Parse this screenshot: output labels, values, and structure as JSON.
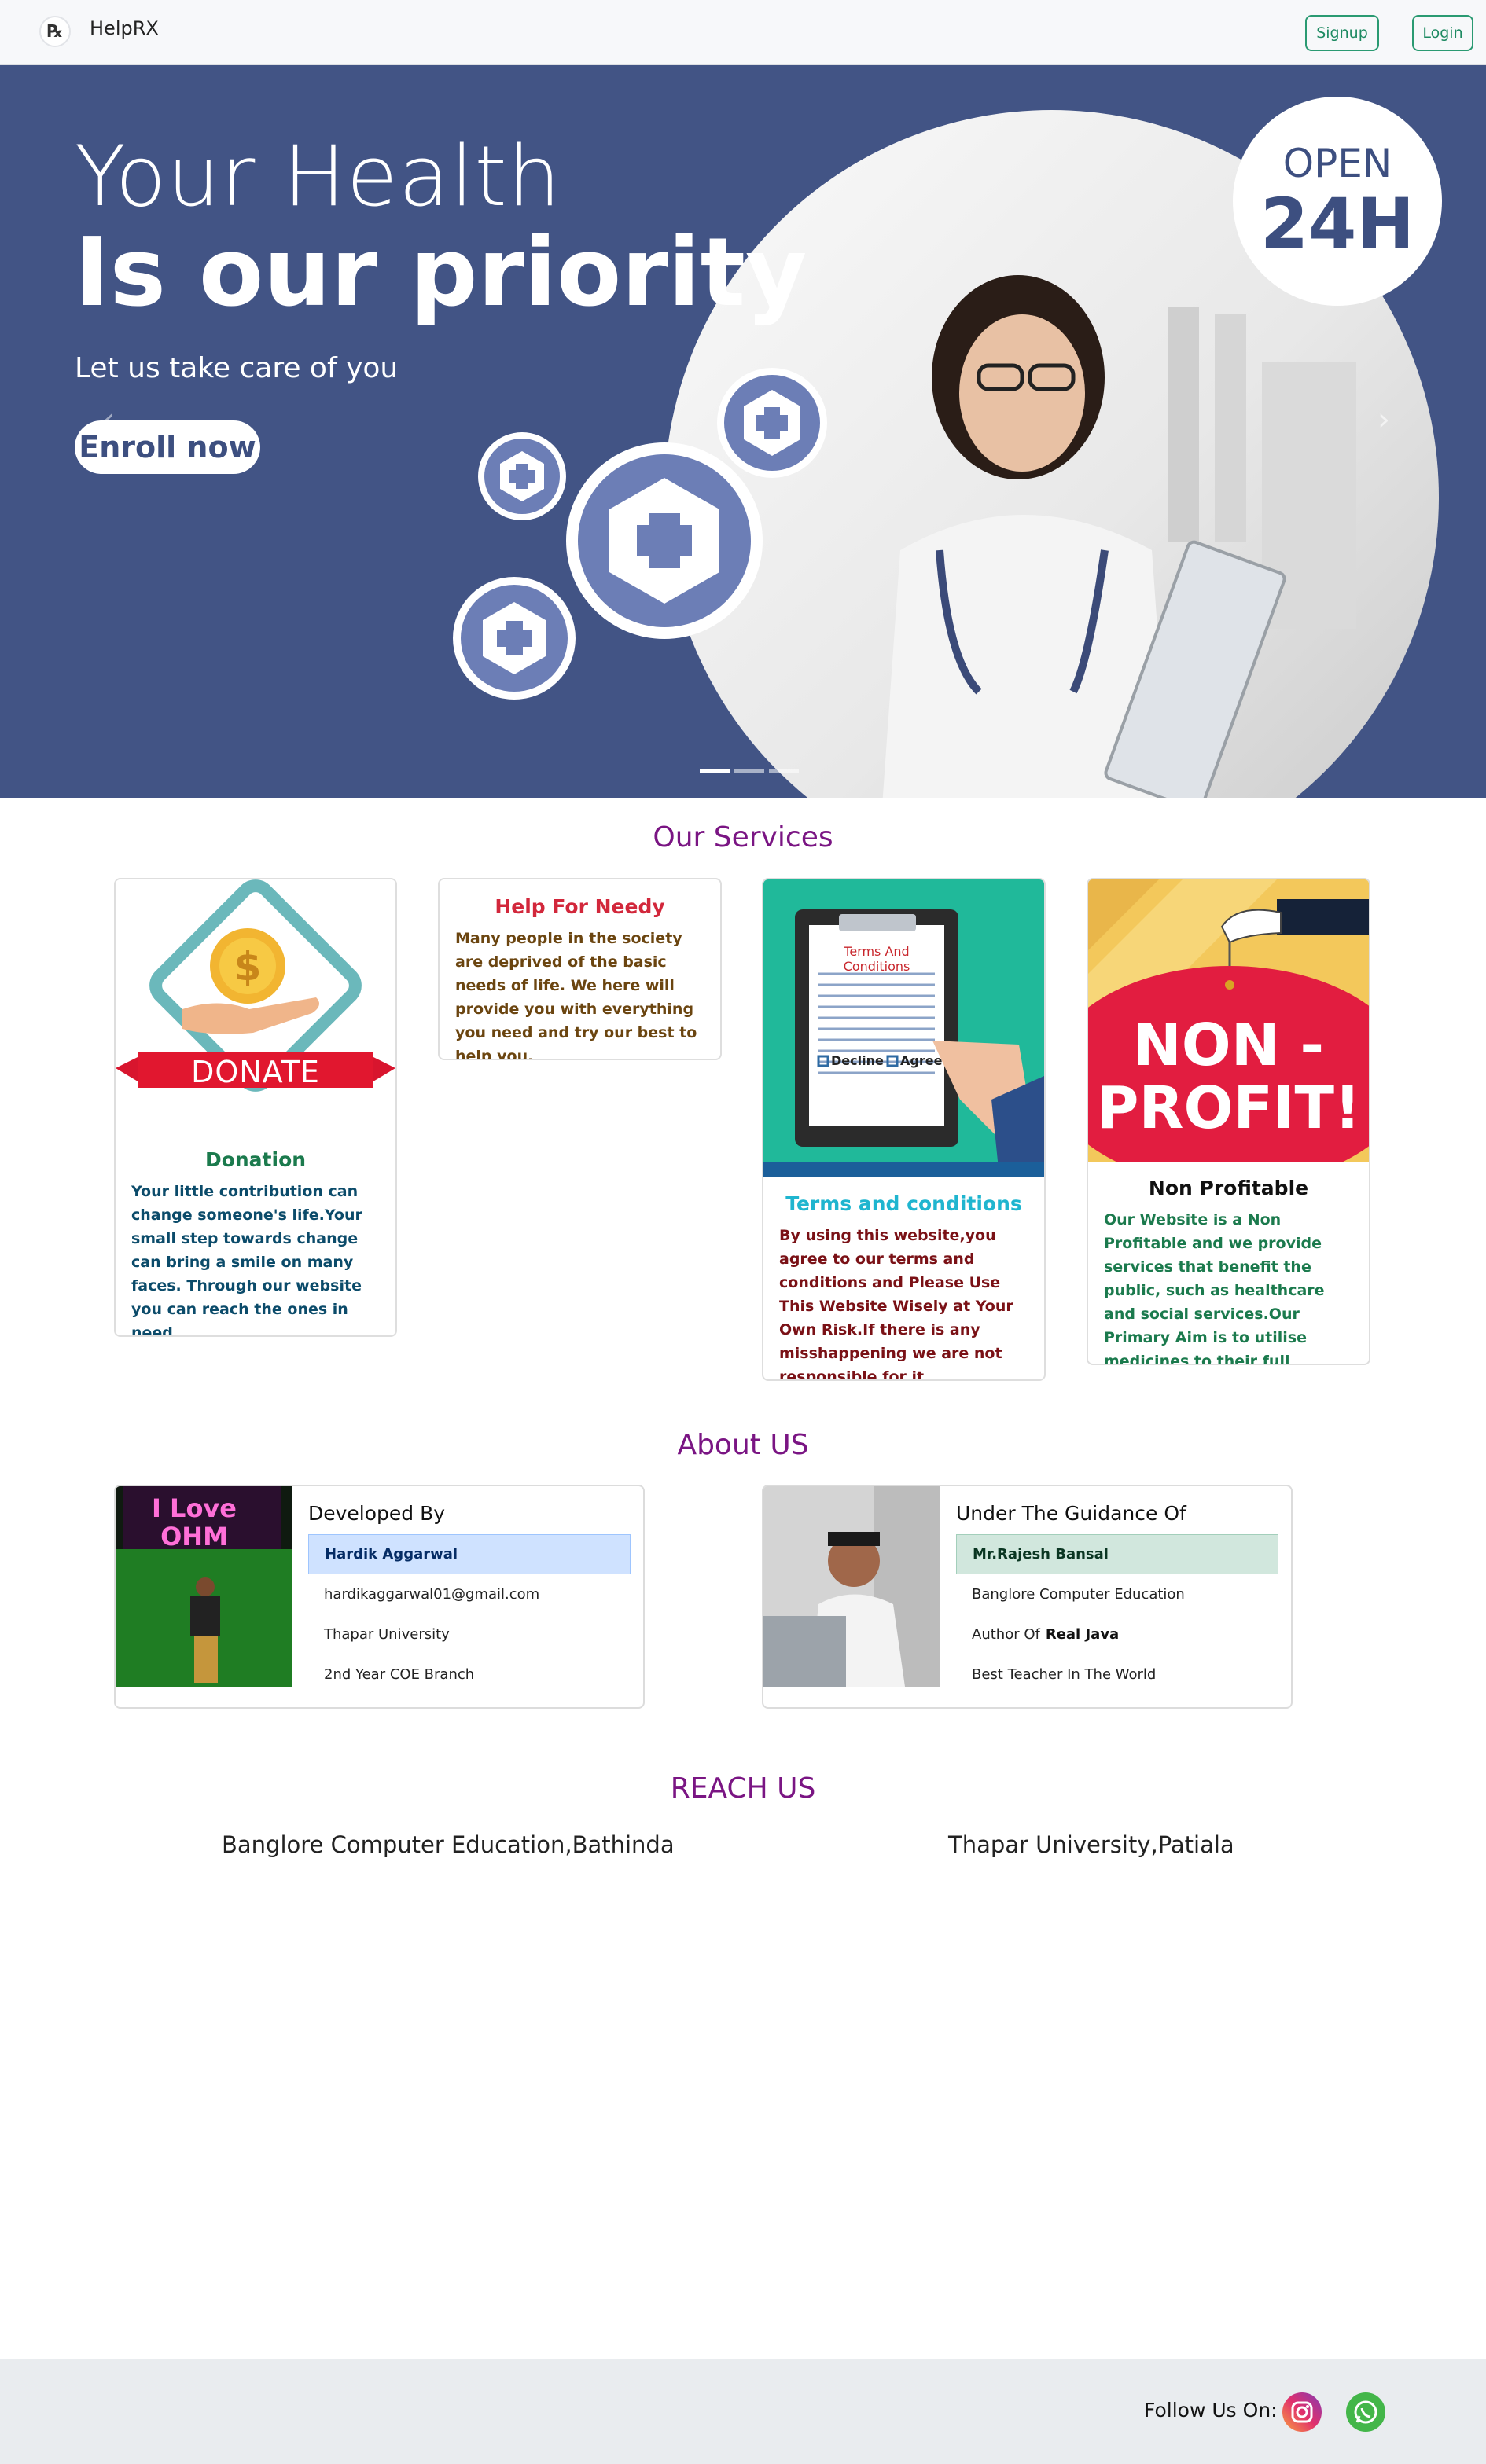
{
  "navbar": {
    "brand_icon": "rx-icon",
    "brand": "HelpRX",
    "signup": "Signup",
    "login": "Login"
  },
  "hero": {
    "title_line1": "Your Health",
    "title_line2": "Is our priority",
    "subtitle": "Let us take care of you",
    "cta": "Enroll now",
    "badge_top": "OPEN",
    "badge_bottom": "24H",
    "carousel_count": 3,
    "active_slide": 1
  },
  "services": {
    "title": "Our Services",
    "donation": {
      "image_text": "DONATE",
      "title": "Donation",
      "text": "Your little contribution can change someone's life.Your small step towards change can bring a smile on many faces. Through our website you can reach the ones in need."
    },
    "needy": {
      "title": "Help For Needy",
      "text": "Many people in the society are deprived of the basic needs of life. We here will provide you with everything you need and try our best to help you."
    },
    "terms": {
      "image_heading": "Terms And Conditions",
      "image_decline": "Decline",
      "image_agree": "Agree",
      "title": "Terms and conditions",
      "text": "By using this website,you agree to our terms and conditions and Please Use This Website Wisely at Your Own Risk.If there is any misshappening we are not responsible for it."
    },
    "nonprofit": {
      "image_line1": "NON -",
      "image_line2": "PROFIT!",
      "title": "Non Profitable",
      "text": "Our Website is a Non Profitable and we provide services that benefit the public, such as healthcare and social services.Our Primary Aim is to utilise medicines to their full extent."
    }
  },
  "about": {
    "title": "About US",
    "developer": {
      "photo_text": "I Love OHM",
      "heading": "Developed By",
      "name": "Hardik Aggarwal",
      "email": "hardikaggarwal01@gmail.com",
      "college": "Thapar University",
      "branch": "2nd Year COE Branch"
    },
    "guide": {
      "heading": "Under The Guidance Of",
      "name": "Mr.Rajesh Bansal",
      "org": "Banglore Computer Education",
      "author_prefix": "Author Of",
      "author_book": "Real Java",
      "tagline": "Best Teacher In The World"
    }
  },
  "reach": {
    "title": "REACH US",
    "location1": "Banglore Computer Education,Bathinda",
    "location2": "Thapar University,Patiala"
  },
  "footer": {
    "follow": "Follow Us On:",
    "icons": [
      "instagram-icon",
      "whatsapp-icon"
    ]
  },
  "colors": {
    "hero_bg": "#425485",
    "accent_purple": "#7a1583",
    "nav_btn": "#1e8a62"
  }
}
